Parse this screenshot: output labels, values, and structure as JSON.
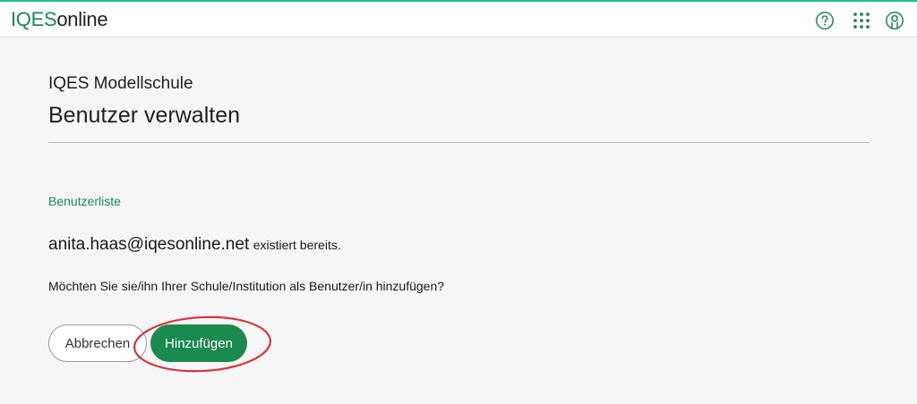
{
  "header": {
    "logo_brand": "IQES",
    "logo_suffix": "online",
    "icons": [
      "help-circle-icon",
      "apps-grid-icon",
      "user-account-icon"
    ],
    "accent_color": "#1fbf86",
    "brand_color": "#1b8a4e"
  },
  "page": {
    "school_name": "IQES Modellschule",
    "title": "Benutzer verwalten",
    "breadcrumb": "Benutzerliste",
    "email": "anita.haas@iqesonline.net",
    "exists_text": "existiert bereits.",
    "question": "Möchten Sie sie/ihn Ihrer Schule/Institution als Benutzer/in hinzufügen?"
  },
  "actions": {
    "cancel_label": "Abbrechen",
    "add_label": "Hinzufügen",
    "highlight_color": "#d9343a"
  }
}
